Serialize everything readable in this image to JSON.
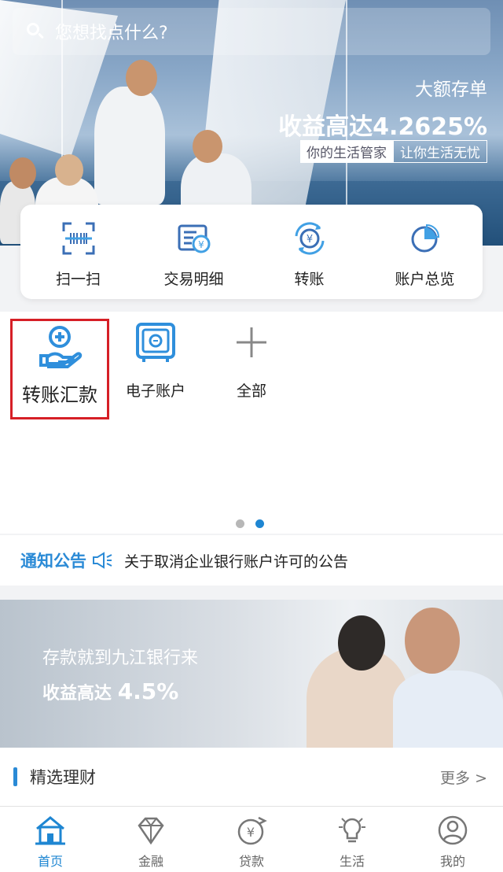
{
  "search": {
    "placeholder": "您想找点什么?"
  },
  "hero": {
    "subtitle": "大额存单",
    "title": "收益高达4.2625%",
    "tags": [
      "你的生活管家",
      "让你生活无忧"
    ]
  },
  "quick_actions": [
    {
      "label": "扫一扫",
      "icon": "scan-icon"
    },
    {
      "label": "交易明细",
      "icon": "transaction-detail-icon"
    },
    {
      "label": "转账",
      "icon": "transfer-icon"
    },
    {
      "label": "账户总览",
      "icon": "account-overview-icon"
    }
  ],
  "grid": [
    {
      "label": "转账汇款",
      "icon": "transfer-remit-icon"
    },
    {
      "label": "电子账户",
      "icon": "e-account-icon"
    },
    {
      "label": "全部",
      "icon": "plus-icon"
    }
  ],
  "pager": {
    "total": 2,
    "active": 2
  },
  "notice": {
    "title": "通知公告",
    "text": "关于取消企业银行账户许可的公告"
  },
  "banner": {
    "line1": "存款就到九江银行来",
    "line2_prefix": "收益高达",
    "line2_value": "4.5%"
  },
  "finance": {
    "title": "精选理财",
    "more": "更多 >"
  },
  "tabbar": [
    {
      "label": "首页",
      "icon": "home-icon",
      "active": true
    },
    {
      "label": "金融",
      "icon": "diamond-icon",
      "active": false
    },
    {
      "label": "贷款",
      "icon": "loan-icon",
      "active": false
    },
    {
      "label": "生活",
      "icon": "bulb-icon",
      "active": false
    },
    {
      "label": "我的",
      "icon": "user-icon",
      "active": false
    }
  ],
  "colors": {
    "accent": "#1e86d2",
    "highlight": "#d61f26"
  }
}
